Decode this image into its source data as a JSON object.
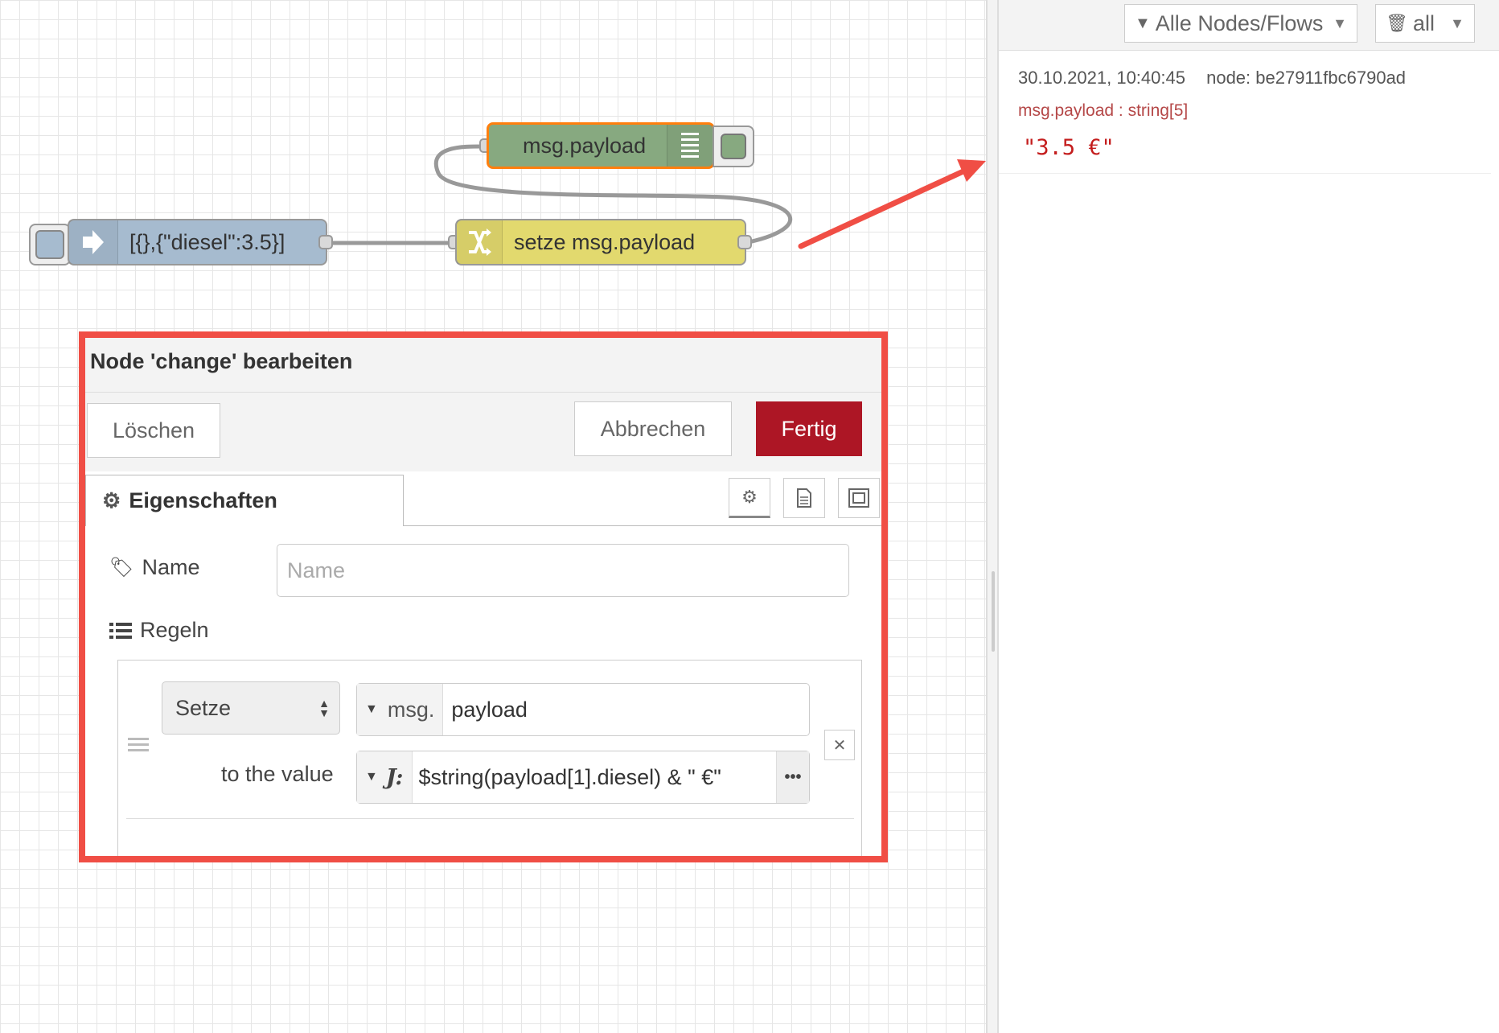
{
  "flow": {
    "inject_label": "[{},{\"diesel\":3.5}]",
    "change_label": "setze msg.payload",
    "debug_label": "msg.payload"
  },
  "sidebar": {
    "filter_label": "Alle Nodes/Flows",
    "clear_label": "all",
    "message": {
      "timestamp": "30.10.2021, 10:40:45",
      "node": "node: be27911fbc6790ad",
      "property": "msg.payload : string[5]",
      "value": "\"3.5 €\""
    }
  },
  "tray": {
    "title": "Node 'change' bearbeiten",
    "delete_label": "Löschen",
    "cancel_label": "Abbrechen",
    "done_label": "Fertig",
    "tab_label": "Eigenschaften",
    "name_label": "Name",
    "name_placeholder": "Name",
    "rules_label": "Regeln",
    "rule": {
      "action": "Setze",
      "target_prefix": "msg.",
      "target_value": "payload",
      "to_label": "to the value",
      "expression": "$string(payload[1].diesel) & \" €\""
    }
  },
  "colors": {
    "inject": "#a6bbcf",
    "change": "#e2d96e",
    "debug": "#87a980",
    "highlight": "#f04e45",
    "primary": "#ad1625"
  }
}
